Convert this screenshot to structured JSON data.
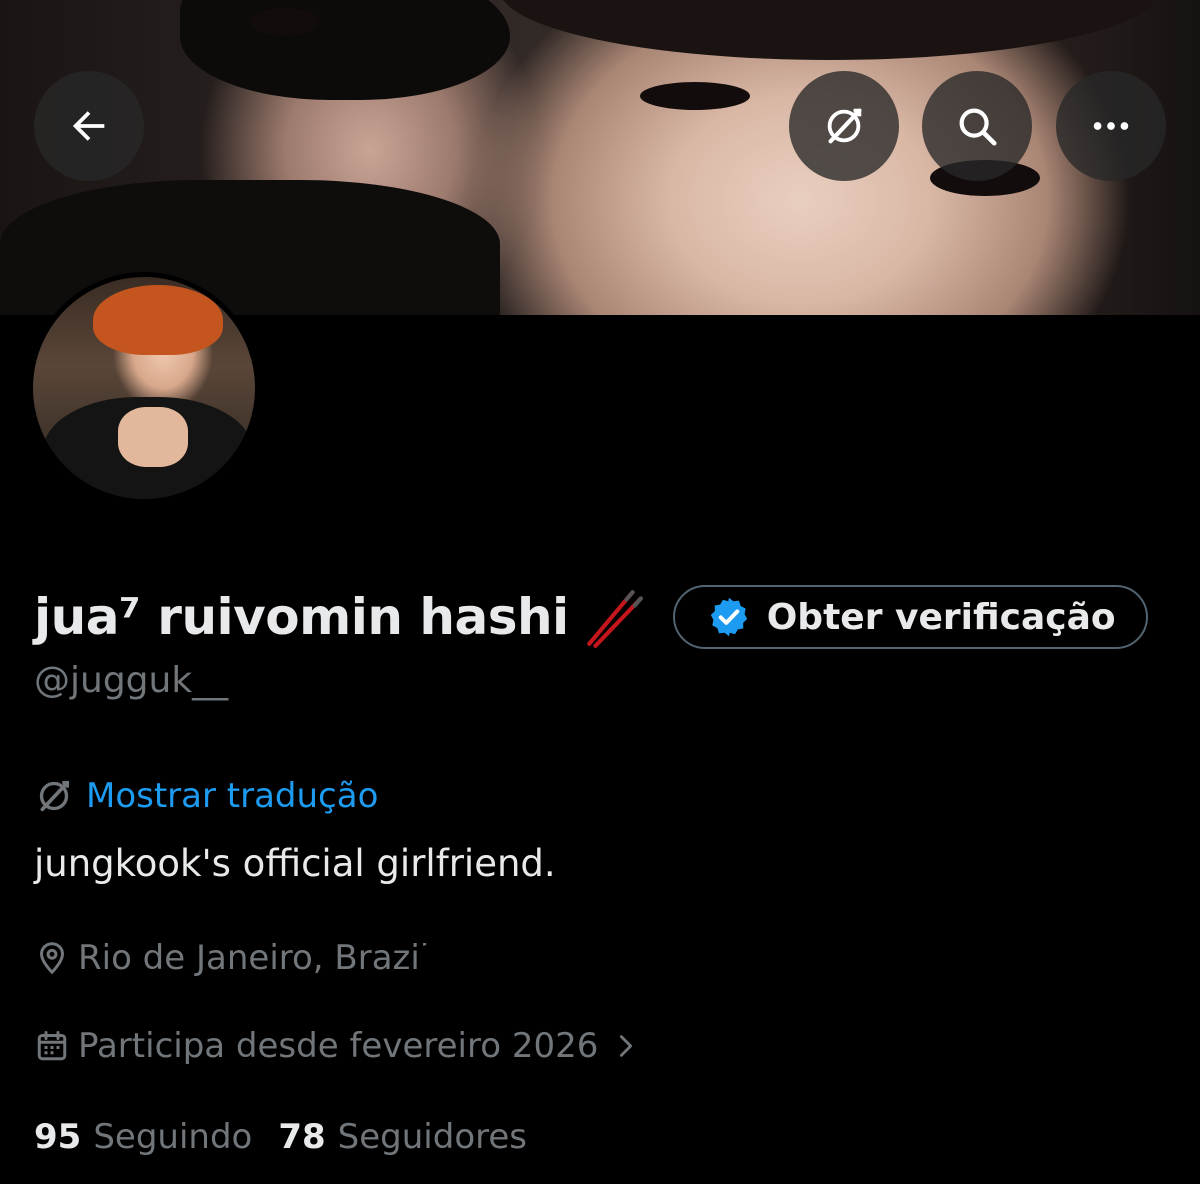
{
  "header": {
    "back_icon": "arrow-left-icon",
    "translate_icon": "translate-globe-icon",
    "search_icon": "search-icon",
    "more_icon": "more-horizontal-icon"
  },
  "profile": {
    "display_name": "jua⁷ ruivomin hashi",
    "name_emoji": "chopsticks-emoji",
    "handle": "@jugguk__",
    "verify_button_label": "Obter verificação",
    "translate_link": "Mostrar tradução",
    "bio": "jungkook's official girlfriend.",
    "location": "Rio de Janeiro, Brazil",
    "joined": "Participa desde fevereiro 2026",
    "following_count": "95",
    "following_label": "Seguindo",
    "followers_count": "78",
    "followers_label": "Seguidores"
  },
  "colors": {
    "background": "#000000",
    "text_primary": "#e7e9ea",
    "text_secondary": "#71767b",
    "link": "#1d9bf0",
    "verified_badge": "#1d9bf0"
  }
}
